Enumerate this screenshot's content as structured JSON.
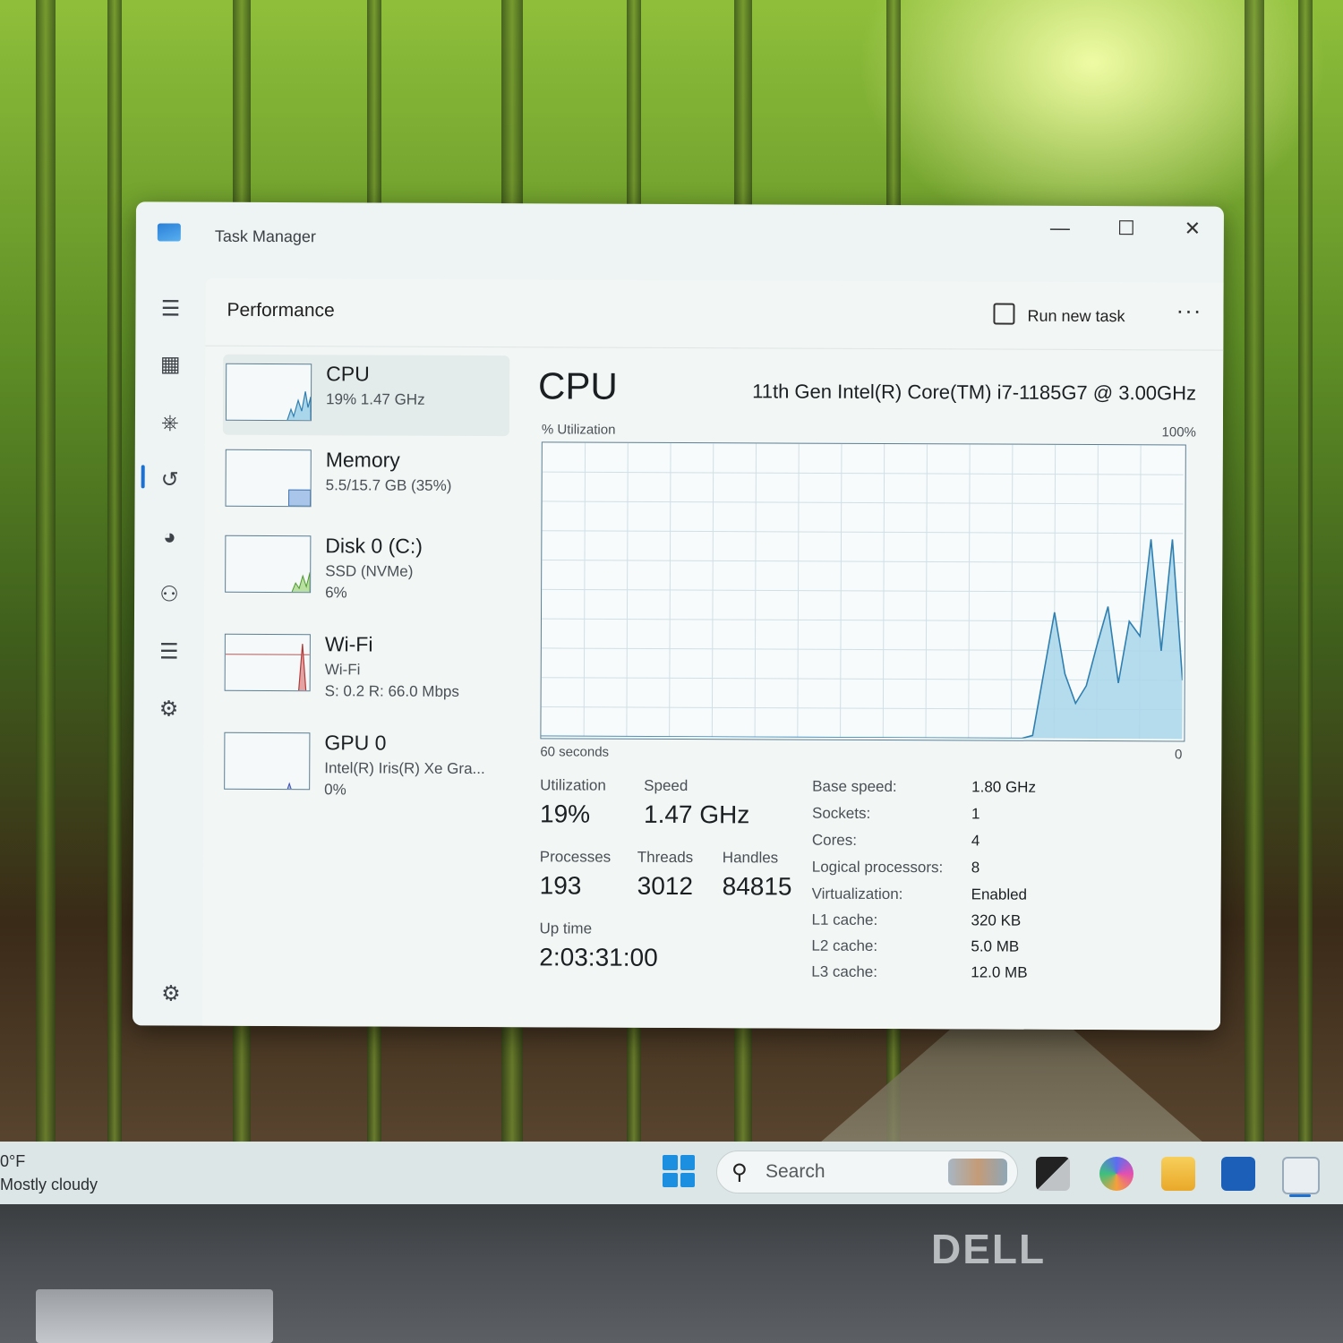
{
  "window": {
    "title": "Task Manager"
  },
  "page": {
    "title": "Performance",
    "run_task_label": "Run new task",
    "more_label": "···"
  },
  "devices": [
    {
      "name": "CPU",
      "line1": "19%  1.47 GHz",
      "line2": ""
    },
    {
      "name": "Memory",
      "line1": "5.5/15.7 GB (35%)",
      "line2": ""
    },
    {
      "name": "Disk 0 (C:)",
      "line1": "SSD (NVMe)",
      "line2": "6%"
    },
    {
      "name": "Wi-Fi",
      "line1": "Wi-Fi",
      "line2": "S: 0.2  R: 66.0 Mbps"
    },
    {
      "name": "GPU 0",
      "line1": "Intel(R) Iris(R) Xe Gra...",
      "line2": "0%"
    }
  ],
  "cpu": {
    "title": "CPU",
    "model": "11th Gen Intel(R) Core(TM) i7-1185G7 @ 3.00GHz",
    "util_axis_label": "% Utilization",
    "util_axis_max": "100%",
    "time_axis_label": "60 seconds",
    "time_axis_end": "0",
    "stats": {
      "utilization_label": "Utilization",
      "utilization": "19%",
      "speed_label": "Speed",
      "speed": "1.47 GHz",
      "processes_label": "Processes",
      "processes": "193",
      "threads_label": "Threads",
      "threads": "3012",
      "handles_label": "Handles",
      "handles": "84815",
      "uptime_label": "Up time",
      "uptime": "2:03:31:00"
    },
    "specs": [
      {
        "key": "Base speed:",
        "value": "1.80 GHz"
      },
      {
        "key": "Sockets:",
        "value": "1"
      },
      {
        "key": "Cores:",
        "value": "4"
      },
      {
        "key": "Logical processors:",
        "value": "8"
      },
      {
        "key": "Virtualization:",
        "value": "Enabled"
      },
      {
        "key": "L1 cache:",
        "value": "320 KB"
      },
      {
        "key": "L2 cache:",
        "value": "5.0 MB"
      },
      {
        "key": "L3 cache:",
        "value": "12.0 MB"
      }
    ]
  },
  "chart_data": {
    "type": "area",
    "x": [
      60,
      50,
      40,
      30,
      20,
      15,
      14,
      12,
      11,
      10,
      9,
      8,
      7,
      6,
      5,
      4,
      3,
      2,
      1,
      0
    ],
    "values": [
      0,
      0,
      0,
      0,
      0,
      0,
      1,
      43,
      22,
      12,
      18,
      32,
      45,
      19,
      40,
      35,
      68,
      30,
      68,
      20
    ],
    "xlabel": "60 seconds",
    "ylabel": "% Utilization",
    "ylim": [
      0,
      100
    ],
    "grid": true
  },
  "taskbar": {
    "weather_temp": "0°F",
    "weather_desc": "Mostly cloudy",
    "search_label": "Search"
  },
  "icons": {
    "hamburger": "hamburger-icon",
    "processes": "processes-icon",
    "performance": "performance-icon",
    "history": "app-history-icon",
    "startup": "startup-apps-icon",
    "users": "users-icon",
    "details": "details-icon",
    "services": "services-icon",
    "settings": "settings-icon"
  },
  "colors": {
    "accent": "#1d6fd0",
    "graph_line": "#2f7fb0",
    "graph_fill": "#a9d6ea",
    "grid": "#cfe0e6"
  },
  "brand": "DELL"
}
